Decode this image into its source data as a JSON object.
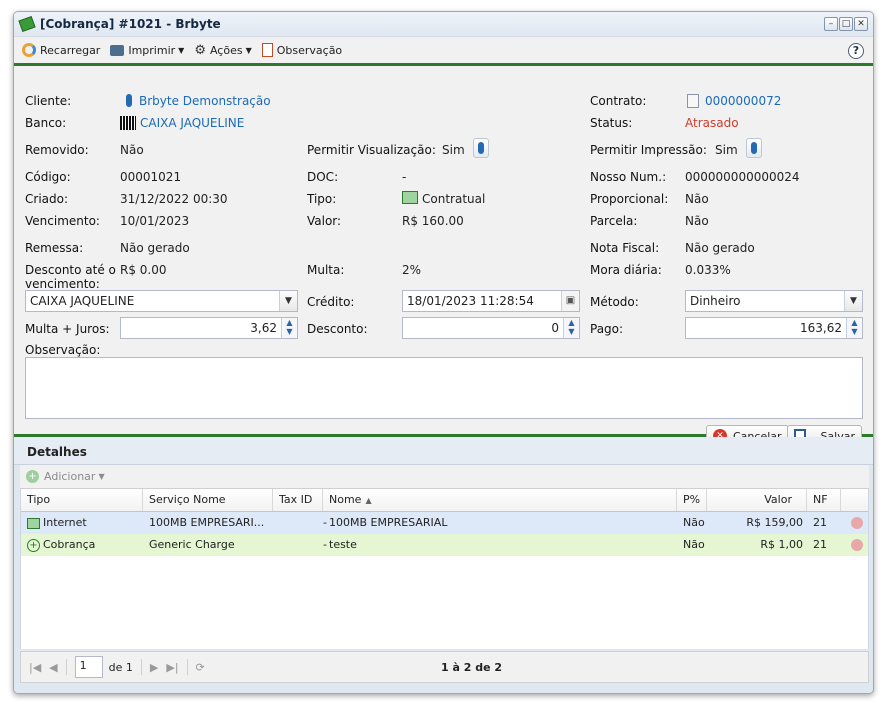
{
  "window": {
    "title": "[Cobrança] #1021 - Brbyte",
    "controls": [
      "–",
      "□",
      "✕"
    ]
  },
  "toolbar": {
    "reload": "Recarregar",
    "print": "Imprimir",
    "actions": "Ações",
    "note": "Observação",
    "help": "?"
  },
  "form": {
    "cliente_label": "Cliente:",
    "cliente_value": "Brbyte Demonstração",
    "contrato_label": "Contrato:",
    "contrato_value": "0000000072",
    "banco_label": "Banco:",
    "banco_value": "CAIXA JAQUELINE",
    "status_label": "Status:",
    "status_value": "Atrasado",
    "removido_label": "Removido:",
    "removido_value": "Não",
    "perm_vis_label": "Permitir Visualização:",
    "perm_vis_value": "Sim",
    "perm_imp_label": "Permitir Impressão:",
    "perm_imp_value": "Sim",
    "codigo_label": "Código:",
    "codigo_value": "00001021",
    "doc_label": "DOC:",
    "doc_value": "-",
    "nosso_label": "Nosso Num.:",
    "nosso_value": "000000000000024",
    "criado_label": "Criado:",
    "criado_value": "31/12/2022 00:30",
    "tipo_label": "Tipo:",
    "tipo_value": "Contratual",
    "proporcional_label": "Proporcional:",
    "proporcional_value": "Não",
    "vencimento_label": "Vencimento:",
    "vencimento_value": "10/01/2023",
    "valor_label": "Valor:",
    "valor_value": "R$ 160.00",
    "parcela_label": "Parcela:",
    "parcela_value": "Não",
    "remessa_label": "Remessa:",
    "remessa_value": "Não gerado",
    "nota_label": "Nota Fiscal:",
    "nota_value": "Não gerado",
    "desconto_ate_label_1": "Desconto até o",
    "desconto_ate_label_2": "vencimento:",
    "desconto_ate_value": "R$ 0.00",
    "multa_label": "Multa:",
    "multa_value": "2%",
    "mora_label": "Mora diária:",
    "mora_value": "0.033%",
    "banco_select": "CAIXA JAQUELINE",
    "credito_label": "Crédito:",
    "credito_value": "18/01/2023 11:28:54",
    "metodo_label": "Método:",
    "metodo_value": "Dinheiro",
    "multa_juros_label": "Multa + Juros:",
    "multa_juros_value": "3,62",
    "desconto_label": "Desconto:",
    "desconto_value": "0",
    "pago_label": "Pago:",
    "pago_value": "163,62",
    "observacao_label": "Observação:",
    "observacao_value": ""
  },
  "buttons": {
    "cancel": "Cancelar",
    "save": "Salvar"
  },
  "details": {
    "title": "Detalhes",
    "add": "Adicionar",
    "columns": [
      "Tipo",
      "Serviço Nome",
      "Tax ID",
      "Nome",
      "P%",
      "Valor",
      "NF"
    ],
    "rows": [
      {
        "tipo": "Internet",
        "servico": "100MB EMPRESARI...",
        "tax": "-",
        "nome": "100MB EMPRESARIAL",
        "p": "Não",
        "valor": "R$ 159,00",
        "nf": "21"
      },
      {
        "tipo": "Cobrança",
        "servico": "Generic Charge",
        "tax": "-",
        "nome": "teste",
        "p": "Não",
        "valor": "R$ 1,00",
        "nf": "21"
      }
    ],
    "row_colors": [
      "#dde8f8",
      "#e4f6d2"
    ]
  },
  "pager": {
    "page": "1",
    "of": "de 1",
    "summary": "1 à 2 de 2"
  }
}
